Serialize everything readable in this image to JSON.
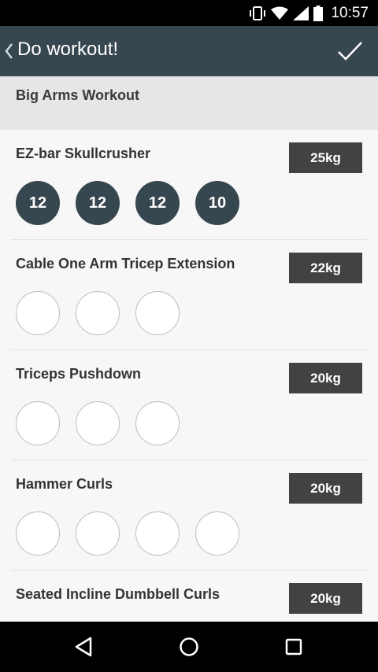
{
  "status_bar": {
    "time": "10:57",
    "icons": [
      "vibrate-icon",
      "wifi-icon",
      "signal-icon",
      "battery-icon"
    ]
  },
  "app_bar": {
    "title": "Do workout!",
    "back_icon": "chevron-left-icon",
    "action_icon": "checkmark-icon"
  },
  "workout": {
    "name": "Big Arms Workout"
  },
  "exercises": [
    {
      "name": "EZ-bar Skullcrusher",
      "weight": "25kg",
      "sets": [
        "12",
        "12",
        "12",
        "10"
      ],
      "completed": [
        true,
        true,
        true,
        true
      ]
    },
    {
      "name": "Cable One Arm Tricep Extension",
      "weight": "22kg",
      "sets": [
        "",
        "",
        ""
      ],
      "completed": [
        false,
        false,
        false
      ]
    },
    {
      "name": "Triceps Pushdown",
      "weight": "20kg",
      "sets": [
        "",
        "",
        ""
      ],
      "completed": [
        false,
        false,
        false
      ]
    },
    {
      "name": "Hammer Curls",
      "weight": "20kg",
      "sets": [
        "",
        "",
        "",
        ""
      ],
      "completed": [
        false,
        false,
        false,
        false
      ]
    },
    {
      "name": "Seated Incline Dumbbell Curls",
      "weight": "20kg",
      "sets": [],
      "completed": []
    }
  ],
  "colors": {
    "primary": "#37474f",
    "badge": "#424242",
    "header_bg": "#e6e6e6",
    "content_bg": "#f7f7f7"
  },
  "nav_bar": {
    "icons": [
      "back-icon",
      "home-icon",
      "recents-icon"
    ]
  }
}
